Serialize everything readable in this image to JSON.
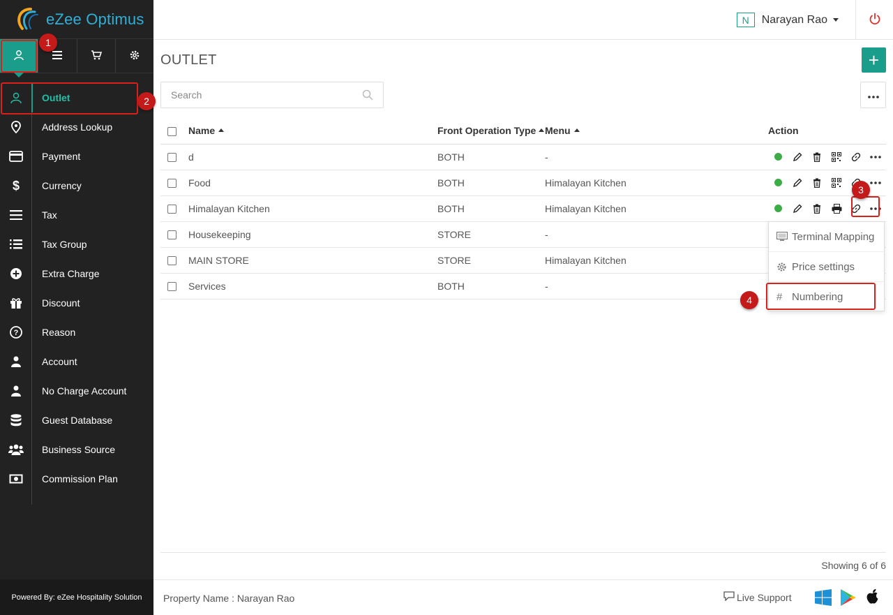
{
  "app": {
    "name": "eZee Optimus"
  },
  "sidebar": {
    "top_tabs": [
      {
        "icon": "user-icon"
      },
      {
        "icon": "list-icon"
      },
      {
        "icon": "cart-icon"
      },
      {
        "icon": "gear-icon"
      }
    ],
    "items": [
      {
        "label": "Outlet",
        "icon": "user-outline-icon",
        "active": true
      },
      {
        "label": "Address Lookup",
        "icon": "map-pin-icon"
      },
      {
        "label": "Payment",
        "icon": "credit-card-icon"
      },
      {
        "label": "Currency",
        "icon": "dollar-icon"
      },
      {
        "label": "Tax",
        "icon": "bars-icon"
      },
      {
        "label": "Tax Group",
        "icon": "list-bullets-icon"
      },
      {
        "label": "Extra Charge",
        "icon": "plus-circle-icon"
      },
      {
        "label": "Discount",
        "icon": "gift-icon"
      },
      {
        "label": "Reason",
        "icon": "question-circle-icon"
      },
      {
        "label": "Account",
        "icon": "person-icon"
      },
      {
        "label": "No Charge Account",
        "icon": "person-icon"
      },
      {
        "label": "Guest Database",
        "icon": "database-icon"
      },
      {
        "label": "Business Source",
        "icon": "users-icon"
      },
      {
        "label": "Commission Plan",
        "icon": "money-icon"
      }
    ],
    "powered_by": "Powered By: eZee Hospitality Solution"
  },
  "header": {
    "user_initial": "N",
    "user_name": "Narayan Rao"
  },
  "main": {
    "title": "OUTLET",
    "add_label": "+",
    "search_placeholder": "Search",
    "columns": {
      "name": "Name",
      "front_operation_type": "Front Operation Type",
      "menu": "Menu",
      "action": "Action"
    },
    "rows": [
      {
        "name": "d",
        "type": "BOTH",
        "menu": "-"
      },
      {
        "name": "Food",
        "type": "BOTH",
        "menu": "Himalayan Kitchen"
      },
      {
        "name": "Himalayan Kitchen",
        "type": "BOTH",
        "menu": "Himalayan Kitchen"
      },
      {
        "name": "Housekeeping",
        "type": "STORE",
        "menu": "-"
      },
      {
        "name": "MAIN STORE",
        "type": "STORE",
        "menu": "Himalayan Kitchen"
      },
      {
        "name": "Services",
        "type": "BOTH",
        "menu": "-"
      }
    ],
    "dropdown": [
      {
        "label": "Terminal Mapping",
        "icon": "monitor-icon"
      },
      {
        "label": "Price settings",
        "icon": "gear-icon"
      },
      {
        "label": "Numbering",
        "icon": "hash-icon"
      }
    ],
    "showing": "Showing 6 of 6"
  },
  "footer": {
    "property": "Property Name : Narayan Rao",
    "live_support": "Live Support"
  },
  "callouts": [
    "1",
    "2",
    "3",
    "4"
  ],
  "colors": {
    "accent": "#1a9e8b",
    "sidebar": "#222222",
    "status_green": "#3eab48",
    "callout_red": "#c41a1a"
  }
}
